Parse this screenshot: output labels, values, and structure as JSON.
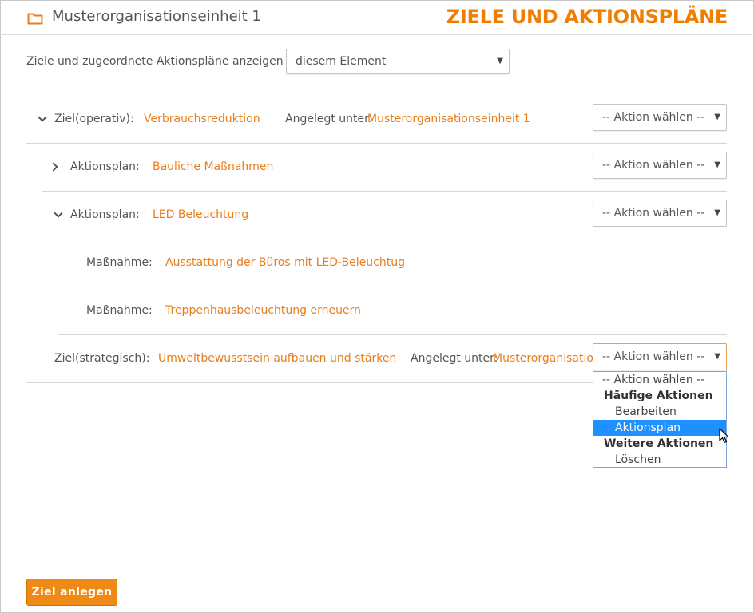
{
  "header": {
    "unit_name": "Musterorganisationseinheit 1",
    "page_title": "ZIELE UND AKTIONSPLÄNE"
  },
  "filter": {
    "label": "Ziele und zugeordnete Aktionspläne anzeigen von",
    "selected": "diesem Element"
  },
  "rows": {
    "goal1": {
      "type_label": "Ziel(operativ):",
      "name": "Verbrauchsreduktion",
      "created_label": "Angelegt unter:",
      "created_value": "Musterorganisationseinheit 1",
      "action": "-- Aktion wählen --"
    },
    "plan1": {
      "type_label": "Aktionsplan:",
      "name": "Bauliche Maßnahmen",
      "action": "-- Aktion wählen --"
    },
    "plan2": {
      "type_label": "Aktionsplan:",
      "name": "LED Beleuchtung",
      "action": "-- Aktion wählen --"
    },
    "measure1": {
      "type_label": "Maßnahme:",
      "name": "Ausstattung der Büros mit LED-Beleuchtug"
    },
    "measure2": {
      "type_label": "Maßnahme:",
      "name": "Treppenhausbeleuchtung erneuern"
    },
    "goal2": {
      "type_label": "Ziel(strategisch):",
      "name": "Umweltbewusstsein aufbauen und stärken",
      "created_label": "Angelegt unter:",
      "created_value": "Musterorganisation",
      "action": "-- Aktion wählen --"
    }
  },
  "dropdown": {
    "placeholder": "-- Aktion wählen --",
    "group1": "Häufige Aktionen",
    "edit": "Bearbeiten",
    "create_plan": "Aktionsplan anlegen",
    "group2": "Weitere Aktionen",
    "delete": "Löschen"
  },
  "footer": {
    "create_goal": "Ziel anlegen"
  },
  "colors": {
    "accent": "#f07d00",
    "link": "#e87e1a",
    "highlight": "#1e90ff"
  }
}
